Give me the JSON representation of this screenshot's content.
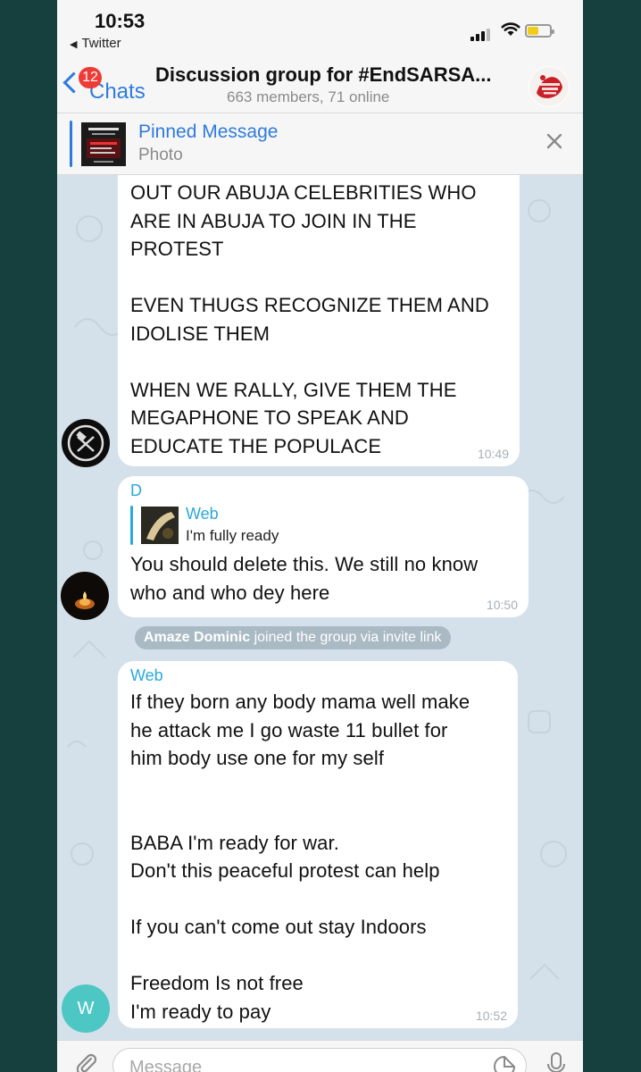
{
  "status_bar": {
    "time": "10:53",
    "back_app": "Twitter"
  },
  "nav": {
    "back_label": "Chats",
    "unread_badge": "12",
    "title": "Discussion group for #EndSARSA...",
    "subtitle": "663 members, 71 online"
  },
  "pinned": {
    "title": "Pinned Message",
    "subtitle": "Photo"
  },
  "messages": [
    {
      "text": "OUT OUR ABUJA CELEBRITIES WHO\nARE IN ABUJA TO JOIN IN THE\nPROTEST\n\nEVEN THUGS RECOGNIZE THEM AND\nIDOLISE THEM\n\nWHEN WE RALLY, GIVE THEM THE\nMEGAPHONE TO SPEAK AND\nEDUCATE THE POPULACE",
      "time": "10:49"
    },
    {
      "sender": "D",
      "reply_to_name": "Web",
      "reply_to_text": "I'm fully ready",
      "text": "You should delete this. We still no know\nwho and who dey here",
      "time": "10:50"
    },
    {
      "sender": "Web",
      "avatar_letter": "W",
      "text": "If they born any body mama well make\nhe attack me I go waste 11 bullet for\nhim body use one for my self\n\n\nBABA I'm ready for war.\nDon't this peaceful protest can help\n\nIf you can't come out stay Indoors\n\nFreedom Is not free\nI'm ready to pay",
      "time": "10:52"
    }
  ],
  "service_message": {
    "name": "Amaze Dominic",
    "action": "joined the group via invite link"
  },
  "input": {
    "placeholder": "Message"
  },
  "colors": {
    "accent": "#2f7bdc",
    "chat_background": "#d4e1ea",
    "sender_name": "#29a9dc",
    "badge": "#ee3b36",
    "page_frame": "#16403e"
  }
}
